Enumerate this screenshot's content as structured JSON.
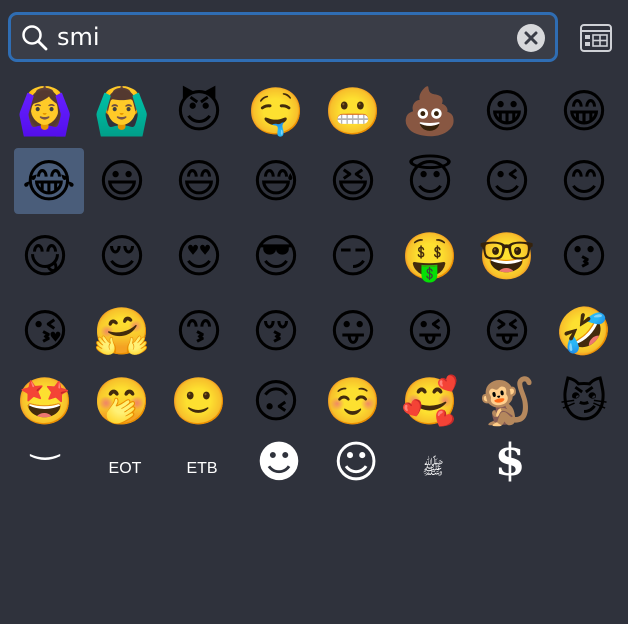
{
  "search": {
    "query": "smi"
  },
  "grid": {
    "row1": [
      "🙆‍♀️",
      "🙆‍♂️",
      "😈",
      "🤤",
      "😬",
      "💩",
      "😀",
      "😁"
    ],
    "row2": [
      "😂",
      "😃",
      "😄",
      "😅",
      "😆",
      "😇",
      "😉",
      "😊"
    ],
    "row3": [
      "😋",
      "😌",
      "😍",
      "😎",
      "😏",
      "🤑",
      "🤓",
      "😗"
    ],
    "row4": [
      "😘",
      "🤗",
      "😙",
      "😚",
      "😛",
      "😜",
      "😝",
      "🤣"
    ],
    "row5": [
      "🤩",
      "🤭",
      "🙂",
      "🙃",
      "☺️",
      "🥰",
      "🐒",
      "😼"
    ],
    "row6": {
      "smile_curve": "‿",
      "eot": "EOT",
      "etb": "ETB",
      "smiley_filled": "☻",
      "smiley_outline": "☺",
      "arabic_ligature": "ﷺ",
      "dollar_glyph": "$"
    }
  },
  "icons": {
    "search": "search-icon",
    "clear": "close-circle-icon",
    "viewer": "character-viewer-icon"
  },
  "colors": {
    "background": "#2f323c",
    "search_border": "#2f6db3",
    "selected_cell": "#4a5d7a"
  }
}
